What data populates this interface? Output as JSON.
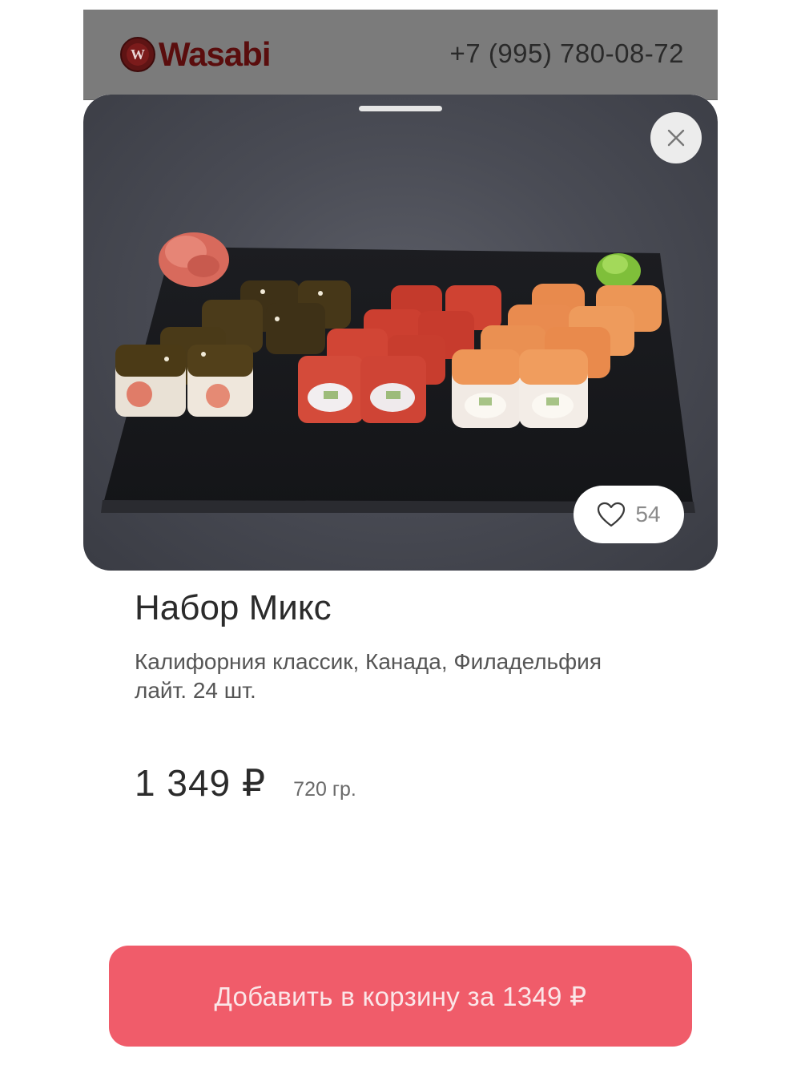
{
  "header": {
    "logo_mark": "W",
    "logo_text": "Wasabi",
    "phone": "+7 (995) 780-08-72"
  },
  "product": {
    "title": "Набор Микс",
    "description": "Калифорния классик, Канада, Филадельфия лайт. 24 шт.",
    "price": "1 349 ₽",
    "weight": "720 гр.",
    "likes": "54",
    "image": "sushi-set-photo"
  },
  "actions": {
    "close_icon": "close-icon",
    "like_icon": "heart-icon",
    "add_to_cart_label": "Добавить в корзину за 1349 ₽"
  },
  "colors": {
    "accent": "#f05c6a",
    "overlay_header": "#7b7b7b",
    "brand": "#5a0d0d"
  }
}
